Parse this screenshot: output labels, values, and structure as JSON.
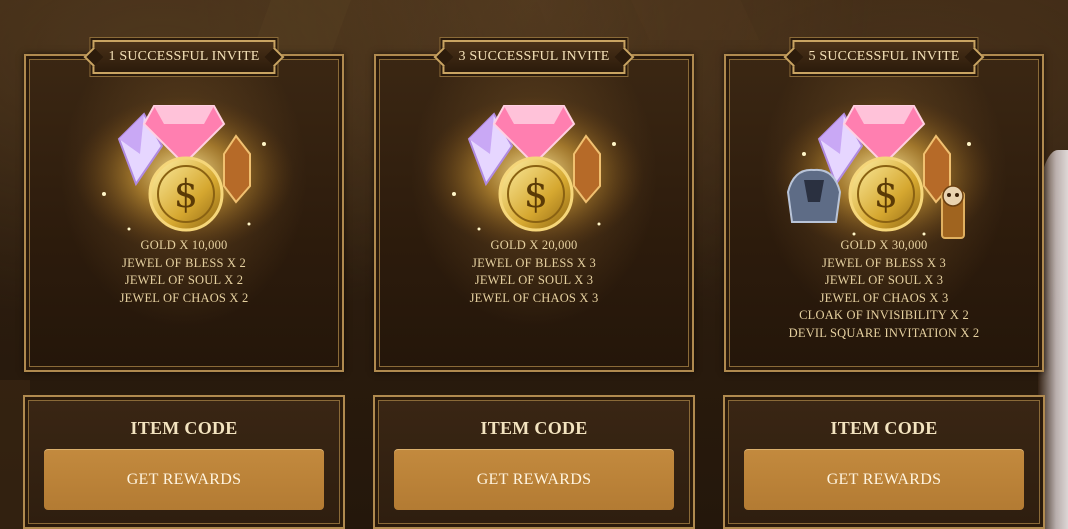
{
  "cards": [
    {
      "banner": "1 SUCCESSFUL INVITE",
      "items": [
        "GOLD X 10,000",
        "JEWEL OF BLESS X 2",
        "JEWEL OF SOUL X 2",
        "JEWEL OF CHAOS X 2"
      ],
      "code_title": "ITEM CODE",
      "button": "GET REWARDS"
    },
    {
      "banner": "3 SUCCESSFUL INVITE",
      "items": [
        "GOLD X 20,000",
        "JEWEL OF BLESS X 3",
        "JEWEL OF SOUL X 3",
        "JEWEL OF CHAOS X 3"
      ],
      "code_title": "ITEM CODE",
      "button": "GET REWARDS"
    },
    {
      "banner": "5 SUCCESSFUL INVITE",
      "items": [
        "GOLD X 30,000",
        "JEWEL OF BLESS X 3",
        "JEWEL OF SOUL X 3",
        "JEWEL OF CHAOS X  3",
        "CLOAK OF INVISIBILITY X 2",
        "DEVIL SQUARE INVITATION X 2"
      ],
      "code_title": "ITEM CODE",
      "button": "GET REWARDS"
    }
  ],
  "icons": {
    "gold": "gold-coin-icon",
    "bless": "pink-diamond-icon",
    "soul": "purple-crystal-icon",
    "chaos": "amber-jewel-icon",
    "cloak": "cloak-icon",
    "devil": "skull-invitation-icon"
  },
  "colors": {
    "frame_gold": "#b08a4f",
    "button": "#c38a3e",
    "text_gold": "#e6d1a0"
  }
}
